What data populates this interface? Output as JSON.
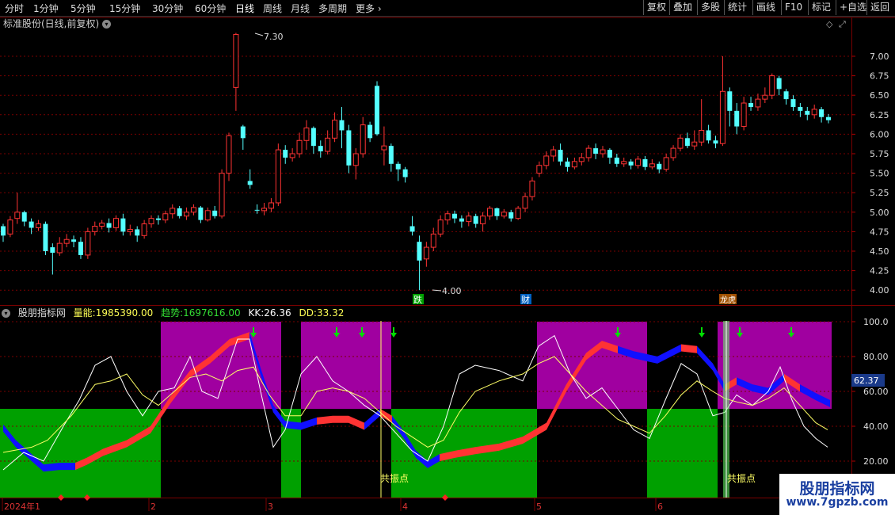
{
  "toolbar": {
    "periods": [
      "分时",
      "1分钟",
      "5分钟",
      "15分钟",
      "30分钟",
      "60分钟",
      "日线",
      "周线",
      "月线",
      "多周期",
      "更多"
    ],
    "active": "日线",
    "right_buttons": [
      "复权",
      "叠加",
      "多股",
      "统计",
      "画线",
      "F10",
      "标记",
      "+自选",
      "返回"
    ]
  },
  "main_chart": {
    "title": "标准股份(日线,前复权)",
    "y_ticks": [
      "7.00",
      "6.75",
      "6.50",
      "6.25",
      "6.00",
      "5.75",
      "5.50",
      "5.25",
      "5.00",
      "4.75",
      "4.50",
      "4.25",
      "4.00"
    ],
    "high_label": "7.30",
    "low_label": "4.00",
    "markers": [
      {
        "text": "跌",
        "bg": "#00a000",
        "fg": "#ffffff"
      },
      {
        "text": "财",
        "bg": "#0060c0",
        "fg": "#ffffff"
      },
      {
        "text": "龙虎",
        "bg": "#a05000",
        "fg": "#ffffff"
      }
    ]
  },
  "indicator": {
    "name": "股朋指标网",
    "liang_label": "量能:",
    "liang_value": "1985390.00",
    "qushi_label": "趋势:",
    "qushi_value": "1697616.00",
    "kk_label": "KK:",
    "kk_value": "26.36",
    "dd_label": "DD:",
    "dd_value": "33.32",
    "y_ticks": [
      "100.0",
      "80.00",
      "60.00",
      "40.00",
      "20.00"
    ],
    "current_value": "62.37",
    "resonance_label": "共振点"
  },
  "x_axis": {
    "labels": [
      "2024年1",
      "2",
      "3",
      "4",
      "5",
      "6"
    ]
  },
  "watermark": {
    "title": "股朋指标网",
    "url": "www.7gpzb.com"
  },
  "colors": {
    "up": "#ff3333",
    "down": "#54ffff",
    "purple": "#a000a0",
    "green": "#00a000",
    "red_ribbon": "#ff3333",
    "blue_ribbon": "#1010ff"
  }
}
